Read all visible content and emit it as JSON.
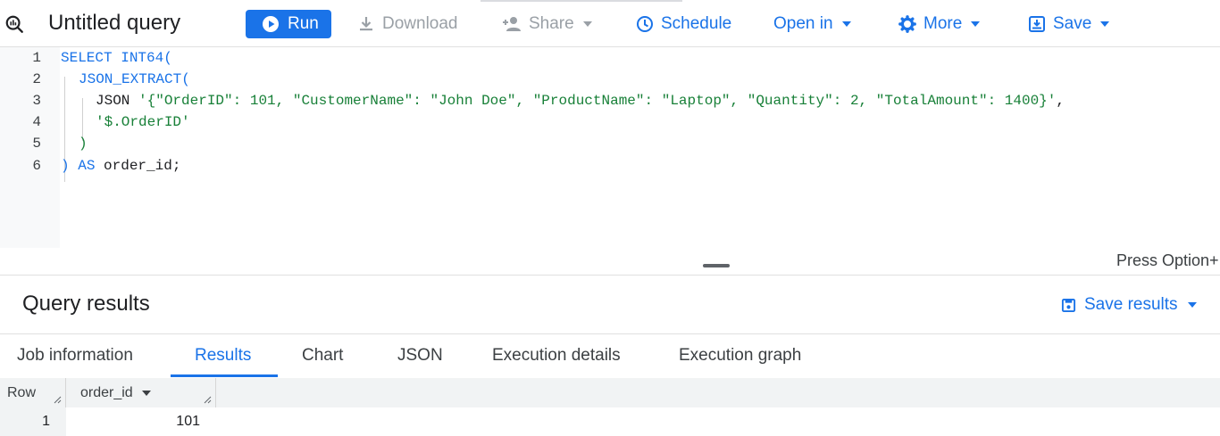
{
  "toolbar": {
    "title": "Untitled query",
    "run_label": "Run",
    "download_label": "Download",
    "share_label": "Share",
    "schedule_label": "Schedule",
    "open_in_label": "Open in",
    "more_label": "More",
    "save_label": "Save"
  },
  "editor": {
    "line_numbers": [
      "1",
      "2",
      "3",
      "4",
      "5",
      "6"
    ],
    "lines": {
      "l1_kw": "SELECT INT64(",
      "l2_kw": "JSON_EXTRACT(",
      "l3_kw": "JSON ",
      "l3_str": "'{\"OrderID\": 101, \"CustomerName\": \"John Doe\", \"ProductName\": \"Laptop\", \"Quantity\": 2, \"TotalAmount\": 1400}'",
      "l3_tail": ",",
      "l4_str": "'$.OrderID'",
      "l5_str": ")",
      "l6_kw1": ")",
      "l6_kw2": " AS",
      "l6_tail": " order_id;"
    }
  },
  "splitter": {
    "hint": "Press Option+"
  },
  "results": {
    "title": "Query results",
    "save_results_label": "Save results",
    "tabs": [
      "Job information",
      "Results",
      "Chart",
      "JSON",
      "Execution details",
      "Execution graph"
    ],
    "columns": [
      "Row",
      "order_id"
    ],
    "rows": [
      {
        "row": "1",
        "order_id": "101"
      }
    ]
  },
  "colors": {
    "accent": "#1a73e8",
    "string": "#188038",
    "disabled": "#9aa0a6"
  }
}
